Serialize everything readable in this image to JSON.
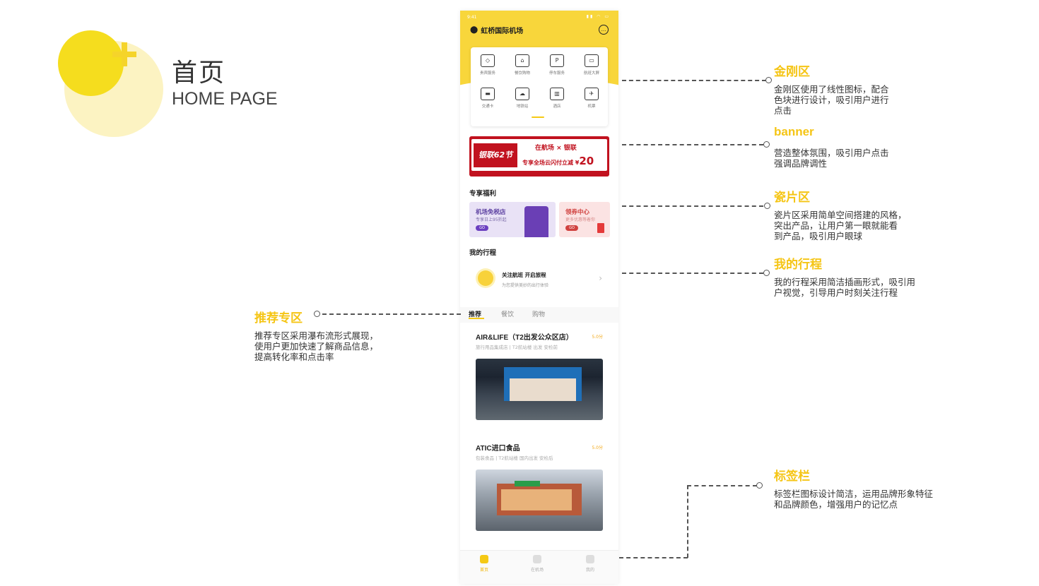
{
  "header": {
    "title": "首页",
    "subtitle": "HOME PAGE"
  },
  "phone": {
    "status_time": "9:41",
    "status_right": "▮▮ ◠ ▭",
    "location": "虹桥国际机场",
    "grid": [
      {
        "label": "贵宾服务",
        "icon": "diamond-icon"
      },
      {
        "label": "餐饮购物",
        "icon": "store-icon"
      },
      {
        "label": "停车服务",
        "icon": "parking-icon"
      },
      {
        "label": "航班大屏",
        "icon": "screen-icon"
      },
      {
        "label": "交通卡",
        "icon": "card-icon"
      },
      {
        "label": "地铁站",
        "icon": "weather-icon"
      },
      {
        "label": "酒店",
        "icon": "hotel-icon"
      },
      {
        "label": "机票",
        "icon": "plane-icon"
      }
    ],
    "banner": {
      "left": "银联62节",
      "line1": "在航场 × 银联",
      "line2_prefix": "专享全场云闪付立减 ¥",
      "line2_amount": "20"
    },
    "welfare": {
      "title": "专享福利",
      "tile1": {
        "title": "机场免税店",
        "sub": "专享日上95折起",
        "btn": "GO"
      },
      "tile2": {
        "title": "领券中心",
        "sub": "更多优惠等着你",
        "btn": "GO"
      }
    },
    "trip": {
      "title": "我的行程",
      "main": "关注航班 开启旅程",
      "sub": "为您提供美妙的出行体验",
      "arrow": "›"
    },
    "tabs": [
      "推荐",
      "餐饮",
      "购物"
    ],
    "feed": [
      {
        "title": "AIR&LIFE（T2出发公众区店）",
        "score": "5.0分",
        "sub": "旅行用品集成店 | T2航站楼 出发 安检前"
      },
      {
        "title": "ATIC进口食品",
        "score": "5.0分",
        "sub": "包装食品 | T2航站楼 国内出发 安检后"
      }
    ],
    "tabbar": [
      "首页",
      "在机场",
      "我的"
    ]
  },
  "annotations": [
    {
      "title": "金刚区",
      "desc": [
        "金刚区使用了线性图标，配合",
        "色块进行设计，吸引用户进行",
        "点击"
      ]
    },
    {
      "title": "banner",
      "desc": [
        "营造整体氛围，吸引用户点击",
        "强调品牌调性"
      ]
    },
    {
      "title": "瓷片区",
      "desc": [
        "瓷片区采用简单空间搭建的风格，",
        "突出产品，让用户第一眼就能看",
        "到产品，吸引用户眼球"
      ]
    },
    {
      "title": "我的行程",
      "desc": [
        "我的行程采用简洁插画形式，吸引用",
        "户视觉，引导用户时刻关注行程"
      ]
    },
    {
      "title": "推荐专区",
      "desc": [
        "推荐专区采用瀑布流形式展现，",
        "使用户更加快速了解商品信息，",
        "提高转化率和点击率"
      ]
    },
    {
      "title": "标签栏",
      "desc": [
        "标签栏图标设计简洁，运用品牌形象特征",
        "和品牌颜色，增强用户的记忆点"
      ]
    }
  ],
  "colors": {
    "accent": "#f5c515",
    "brand_yellow": "#f8d63b",
    "banner_red": "#c1121f"
  }
}
